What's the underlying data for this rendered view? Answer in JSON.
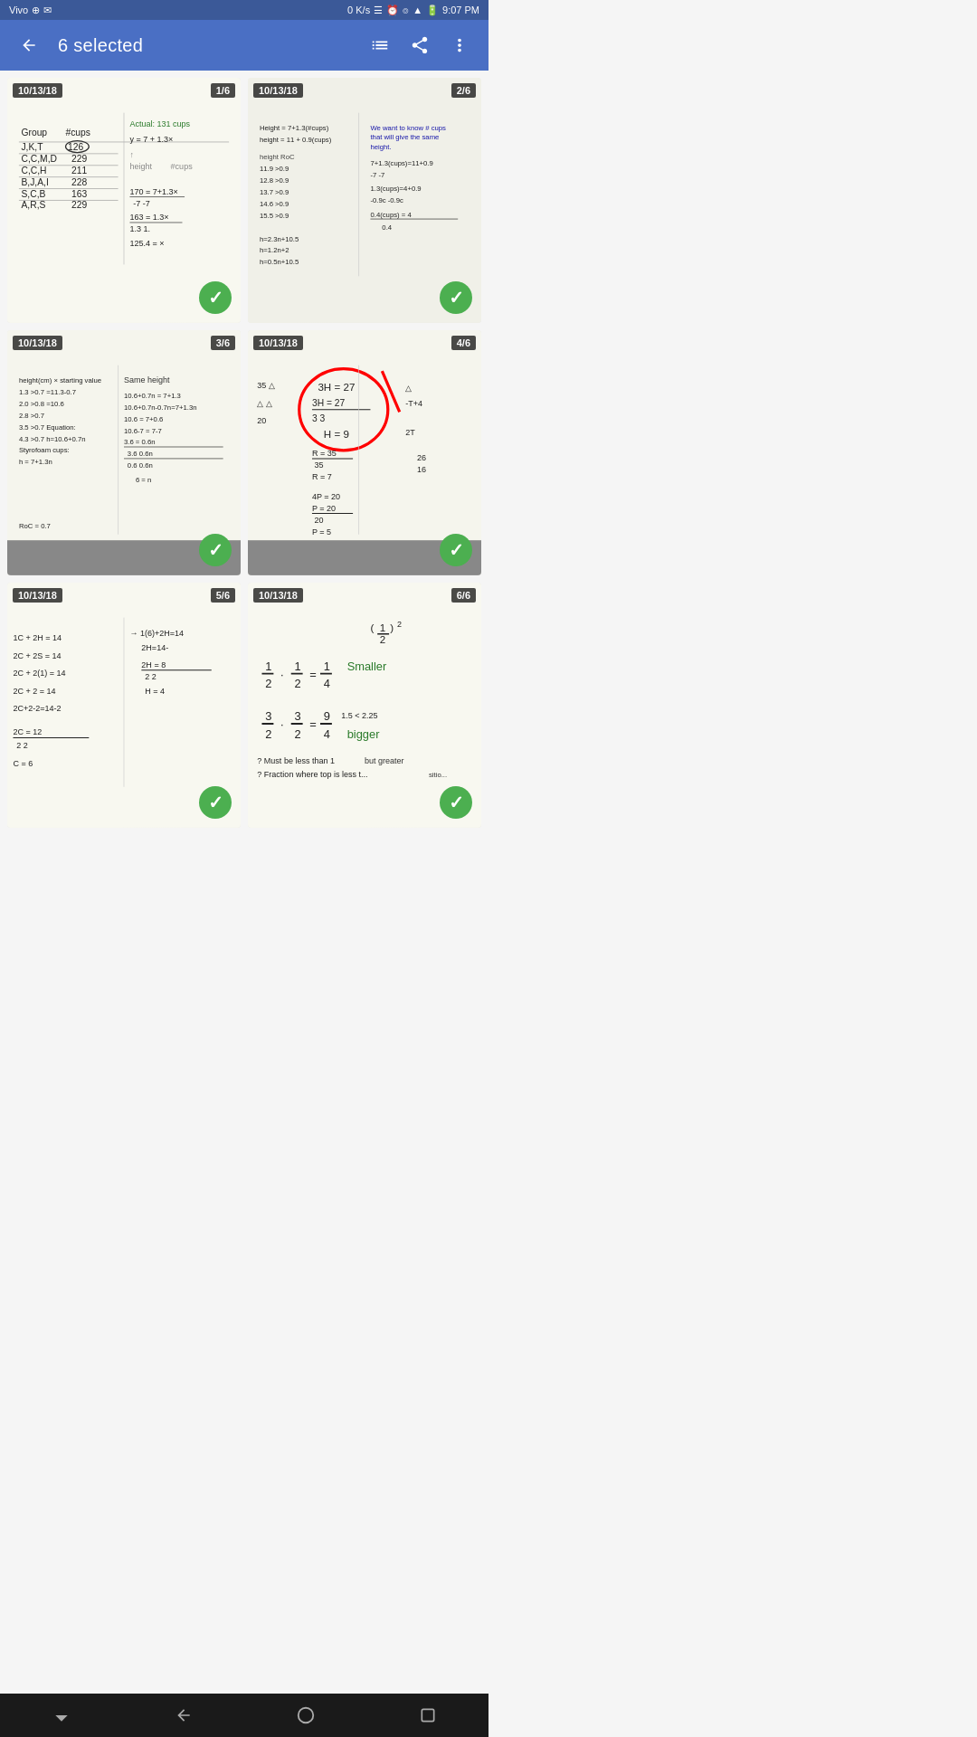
{
  "statusBar": {
    "carrier": "Vivo",
    "usb": "⊕",
    "email": "✉",
    "speed": "0 K/s",
    "signal": "46",
    "battery": "100",
    "time": "9:07 PM"
  },
  "appBar": {
    "title": "6 selected",
    "backLabel": "←",
    "listIcon": "≡",
    "shareIcon": "share",
    "moreIcon": "⋮"
  },
  "grid": {
    "items": [
      {
        "id": 1,
        "date": "10/13/18",
        "number": "1/6",
        "selected": true
      },
      {
        "id": 2,
        "date": "10/13/18",
        "number": "2/6",
        "selected": true
      },
      {
        "id": 3,
        "date": "10/13/18",
        "number": "3/6",
        "selected": true
      },
      {
        "id": 4,
        "date": "10/13/18",
        "number": "4/6",
        "selected": true
      },
      {
        "id": 5,
        "date": "10/13/18",
        "number": "5/6",
        "selected": true
      },
      {
        "id": 6,
        "date": "10/13/18",
        "number": "6/6",
        "selected": true
      }
    ]
  },
  "navBar": {
    "backLabel": "▼",
    "homeLabel": "◁",
    "circleLabel": "○",
    "squareLabel": "▢"
  }
}
